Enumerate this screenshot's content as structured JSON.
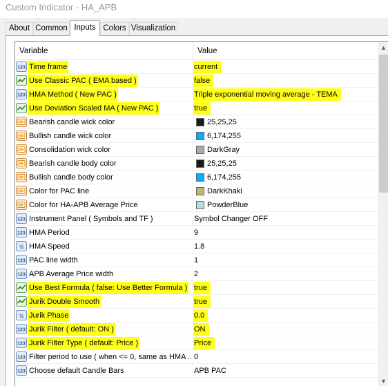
{
  "window": {
    "title": "Custom Indicator - HA_APB"
  },
  "tabs": [
    {
      "label": "About",
      "active": false
    },
    {
      "label": "Common",
      "active": false
    },
    {
      "label": "Inputs",
      "active": true
    },
    {
      "label": "Colors",
      "active": false
    },
    {
      "label": "Visualization",
      "active": false
    }
  ],
  "grid": {
    "columns": {
      "name": "Variable",
      "value": "Value"
    },
    "rows": [
      {
        "name": "Time frame",
        "value": "current",
        "icon": "int-icon",
        "highlight": true
      },
      {
        "name": "Use Classic PAC ( EMA based )",
        "value": "false",
        "icon": "bool-icon",
        "highlight": true
      },
      {
        "name": "HMA Method ( New PAC )",
        "value": "Triple exponential moving average - TEMA",
        "icon": "enum-icon",
        "highlight": true
      },
      {
        "name": "Use Deviation Scaled MA ( New PAC )",
        "value": "true",
        "icon": "bool-icon",
        "highlight": true
      },
      {
        "name": "Bearish candle wick color",
        "value": "25,25,25",
        "icon": "color-icon",
        "swatch": "#191919"
      },
      {
        "name": "Bullish candle wick color",
        "value": "6,174,255",
        "icon": "color-icon",
        "swatch": "#06aeff"
      },
      {
        "name": "Consolidation wick color",
        "value": "DarkGray",
        "icon": "color-icon",
        "swatch": "#a9a9a9"
      },
      {
        "name": "Bearish candle body color",
        "value": "25,25,25",
        "icon": "color-icon",
        "swatch": "#191919"
      },
      {
        "name": "Bullish candle body color",
        "value": "6,174,255",
        "icon": "color-icon",
        "swatch": "#06aeff"
      },
      {
        "name": "Color for PAC line",
        "value": "DarkKhaki",
        "icon": "color-icon",
        "swatch": "#bdb76b"
      },
      {
        "name": "Color for HA-APB Average Price",
        "value": "PowderBlue",
        "icon": "color-icon",
        "swatch": "#b0e0e6"
      },
      {
        "name": "Instrument Panel ( Symbols and TF )",
        "value": "Symbol Changer OFF",
        "icon": "int-icon"
      },
      {
        "name": "HMA Period",
        "value": "9",
        "icon": "int-icon"
      },
      {
        "name": "HMA Speed",
        "value": "1.8",
        "icon": "double-icon"
      },
      {
        "name": "PAC line width",
        "value": "1",
        "icon": "int-icon"
      },
      {
        "name": "APB Average Price width",
        "value": "2",
        "icon": "int-icon"
      },
      {
        "name": "Use Best Formula ( false: Use Better Formula )",
        "value": "true",
        "icon": "bool-icon",
        "highlight": true
      },
      {
        "name": "Jurik Double Smooth",
        "value": "true",
        "icon": "bool-icon",
        "highlight": true
      },
      {
        "name": "Jurik Phase",
        "value": "0.0",
        "icon": "double-icon",
        "highlight": true
      },
      {
        "name": "Jurik Filter ( default: ON )",
        "value": "ON",
        "icon": "int-icon",
        "highlight": true
      },
      {
        "name": "Jurik Filter Type ( default: Price )",
        "value": "Price",
        "icon": "int-icon",
        "highlight": true
      },
      {
        "name": "Filter period to use ( when <= 0, same as HMA ...",
        "value": "0",
        "icon": "int-icon"
      },
      {
        "name": "Choose default Candle Bars",
        "value": "APB PAC",
        "icon": "int-icon"
      }
    ]
  },
  "colors": {
    "highlight": "#ffff1a"
  }
}
